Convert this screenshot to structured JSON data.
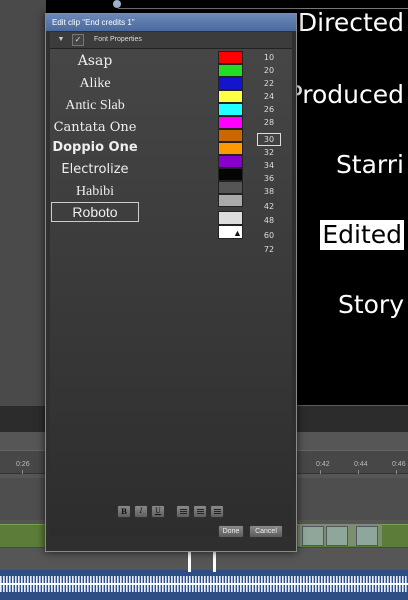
{
  "dialog": {
    "title": "Edit clip \"End credits 1\"",
    "tab_label": "Font Properties",
    "tab_dropdown_glyph": "▼",
    "tab_check_glyph": "✓",
    "fonts": [
      "Asap",
      "Alike",
      "Antic Slab",
      "Cantata One",
      "Doppio One",
      "Electrolize",
      "Habibi",
      "Roboto"
    ],
    "selected_font": "Roboto",
    "colors": [
      "#ff0000",
      "#22dd22",
      "#1414cc",
      "#ffff44",
      "#22ffff",
      "#ff00ff",
      "#cc6600",
      "#ff9900",
      "#8800cc",
      "#050505",
      "#555555",
      "#aaaaaa",
      "#dddddd",
      "#ffffff"
    ],
    "sizes": [
      "10",
      "20",
      "22",
      "24",
      "26",
      "28",
      "30",
      "32",
      "34",
      "36",
      "38",
      "42",
      "48",
      "60",
      "72"
    ],
    "selected_size": "30",
    "format_buttons": {
      "bold": "B",
      "italic": "I",
      "underline": "U"
    },
    "done_label": "Done",
    "cancel_label": "Cancel"
  },
  "preview": {
    "credits": [
      "Directed",
      "Produced",
      "Starri",
      "Edited",
      "Story"
    ],
    "selected_credit": "Edited"
  },
  "timeline": {
    "ruler_labels": [
      "0:26",
      "0:42",
      "0:44",
      "0:46"
    ]
  },
  "icons": {
    "cursor": "arrow-cursor-icon"
  }
}
